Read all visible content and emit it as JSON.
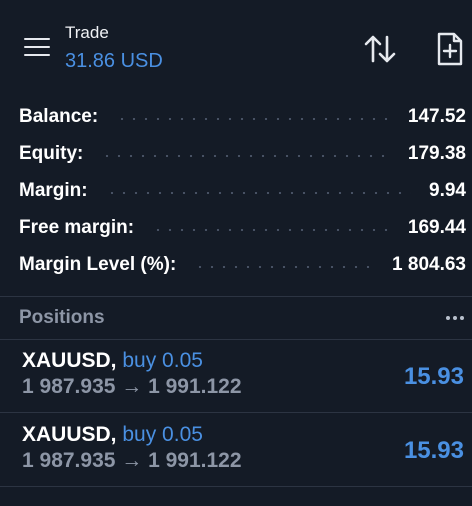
{
  "header": {
    "title": "Trade",
    "subtitle": "31.86 USD",
    "icons": {
      "menu": "hamburger-menu-icon",
      "sort": "sort-arrows-icon",
      "add": "add-document-icon"
    }
  },
  "summary": [
    {
      "label": "Balance:",
      "value": "147.52"
    },
    {
      "label": "Equity:",
      "value": "179.38"
    },
    {
      "label": "Margin:",
      "value": "9.94"
    },
    {
      "label": "Free margin:",
      "value": "169.44"
    },
    {
      "label": "Margin Level (%):",
      "value": "1 804.63"
    }
  ],
  "positions": {
    "title": "Positions",
    "items": [
      {
        "symbol": "XAUUSD,",
        "side": "buy 0.05",
        "prices": "1 987.935 → 1 991.122",
        "profit": "15.93"
      },
      {
        "symbol": "XAUUSD,",
        "side": "buy 0.05",
        "prices": "1 987.935 → 1 991.122",
        "profit": "15.93"
      }
    ]
  },
  "colors": {
    "background": "#141b26",
    "accent_blue": "#4a90e2",
    "muted_text": "#8d96a6",
    "divider": "#2c3442"
  }
}
